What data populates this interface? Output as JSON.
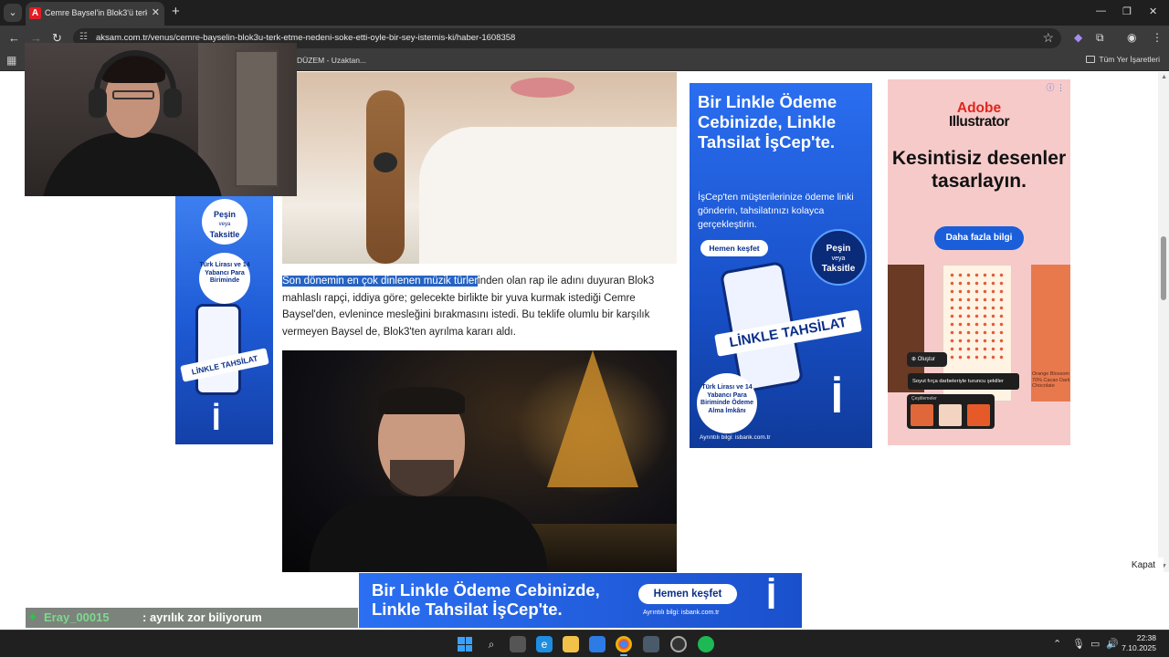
{
  "browser": {
    "tab_title": "Cemre Baysel'in Blok3'ü terk et…",
    "url": "aksam.com.tr/venus/cemre-bayselin-blok3u-terk-etme-nedeni-soke-etti-oyle-bir-sey-istemis-ki/haber-1608358",
    "bookmark_item": "DÜZEM - Uzaktan...",
    "bookmarks_all": "Tüm Yer İşaretleri",
    "accent_color": "#e21b23"
  },
  "article": {
    "selected_text": "Son dönemin en çok dinlenen müzik türler",
    "rest_text": "inden olan rap ile adını duyuran Blok3 mahlaslı rapçi, iddiya göre; gelecekte birlikte bir yuva kurmak istediği Cemre Baysel'den, evlenince mesleğini bırakmasını istedi. Bu teklife olumlu bir karşılık vermeyen Baysel de, Blok3'ten ayrılma kararı aldı."
  },
  "ad_left": {
    "badge1_line1": "Peşin",
    "badge1_line2": "veya",
    "badge1_line3": "Taksitle",
    "badge2": "Türk Lirası ve 14 Yabancı Para Biriminde",
    "strip": "LİNKLE TAHSİLAT",
    "logo": "İ"
  },
  "ad_mid": {
    "headline": "Bir Linkle Ödeme Cebinizde, Linkle Tahsilat İşCep'te.",
    "body": "İşCep'ten müşterilerinize ödeme linki gönderin, tahsilatınızı kolayca gerçekleştirin.",
    "cta": "Hemen keşfet",
    "badge1_line1": "Peşin",
    "badge1_line2": "veya",
    "badge1_line3": "Taksitle",
    "strip": "LİNKLE TAHSİLAT",
    "badge2": "Türk Lirası ve 14 Yabancı Para Biriminde Ödeme Alma İmkânı",
    "logo": "İ",
    "footer": "Ayrıntılı bilgi: isbank.com.tr"
  },
  "ad_right": {
    "brand_line1": "Adobe",
    "brand_line2": "Illustrator",
    "headline": "Kesintisiz desenler tasarlayın.",
    "cta": "Daha fazla bilgi",
    "create_label": "Oluştur",
    "prompt": "Soyut fırça darbeleriyle turuncu şekiller",
    "variations_label": "Çeşitlemeler",
    "product_text": "Orange Blossom 70% Cacao Dark Chocolate",
    "brand_color": "#e0251b"
  },
  "overlay": {
    "close_label": "Kapat",
    "chat_user": "Eray_00015",
    "chat_message": ": ayrılık zor biliyorum"
  },
  "ad_bottom": {
    "line1": "Bir Linkle Ödeme Cebinizde,",
    "line2": "Linkle Tahsilat İşCep'te.",
    "cta": "Hemen keşfet",
    "footer": "Ayrıntılı bilgi: isbank.com.tr",
    "logo": "İ"
  },
  "taskbar": {
    "time": "22:38",
    "date": "7.10.2025"
  }
}
